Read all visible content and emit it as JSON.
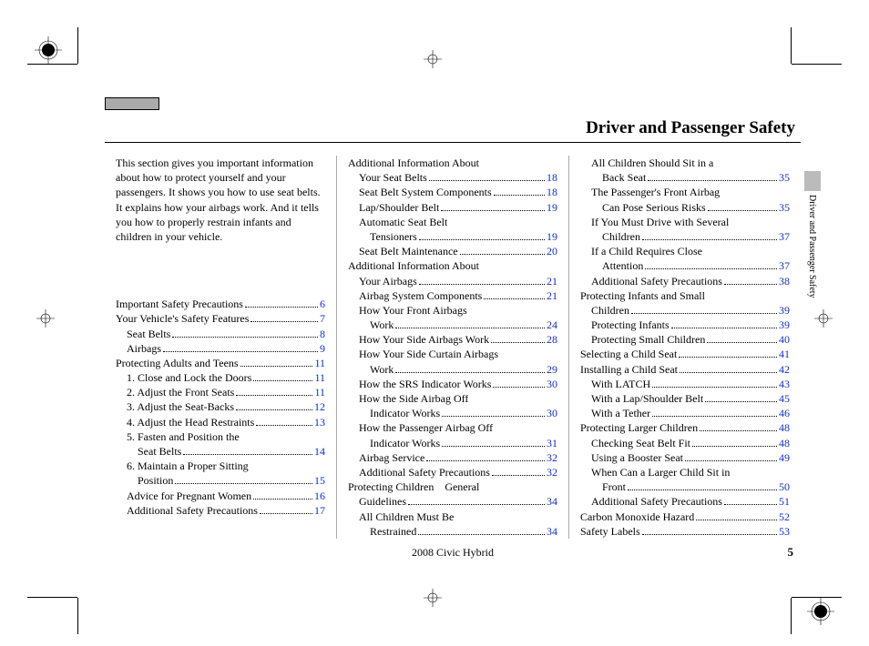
{
  "header": {
    "title": "Driver and Passenger Safety"
  },
  "intro": "This section gives you important information about how to protect yourself and your passengers. It shows you how to use seat belts. It explains how your airbags work. And it tells you how to properly restrain infants and children in your vehicle.",
  "sideLabel": "Driver and Passenger Safety",
  "footer": {
    "model": "2008  Civic  Hybrid",
    "page": "5"
  },
  "pageColor": "#1030c0",
  "col1": [
    {
      "label": "Important Safety Precautions",
      "page": "6",
      "indent": 0
    },
    {
      "label": "Your Vehicle's Safety Features",
      "page": "7",
      "indent": 0
    },
    {
      "label": "Seat Belts",
      "page": "8",
      "indent": 1
    },
    {
      "label": "Airbags",
      "page": "9",
      "indent": 1
    },
    {
      "label": "Protecting Adults and Teens",
      "page": "11",
      "indent": 0
    },
    {
      "label": "1. Close and Lock the Doors",
      "page": "11",
      "indent": 1
    },
    {
      "label": "2. Adjust the Front Seats",
      "page": "11",
      "indent": 1
    },
    {
      "label": "3. Adjust the Seat-Backs",
      "page": "12",
      "indent": 1
    },
    {
      "label": "4. Adjust the Head Restraints",
      "page": "13",
      "indent": 1
    },
    {
      "label": "5. Fasten and Position the",
      "cont": "Seat Belts",
      "page": "14",
      "indent": 1
    },
    {
      "label": "6. Maintain a Proper Sitting",
      "cont": "Position",
      "page": "15",
      "indent": 1
    },
    {
      "label": "Advice for Pregnant Women",
      "page": "16",
      "indent": 1
    },
    {
      "label": "Additional Safety Precautions",
      "page": "17",
      "indent": 1
    }
  ],
  "col2": [
    {
      "label": "Additional Information About",
      "cont": "Your Seat Belts",
      "page": "18",
      "indent": 0
    },
    {
      "label": "Seat Belt System Components",
      "page": "18",
      "indent": 1
    },
    {
      "label": "Lap/Shoulder Belt",
      "page": "19",
      "indent": 1
    },
    {
      "label": "Automatic Seat Belt",
      "cont": "Tensioners",
      "page": "19",
      "indent": 1
    },
    {
      "label": "Seat Belt Maintenance",
      "page": "20",
      "indent": 1
    },
    {
      "label": "Additional Information About",
      "cont": "Your Airbags",
      "page": "21",
      "indent": 0
    },
    {
      "label": "Airbag System Components",
      "page": "21",
      "indent": 1
    },
    {
      "label": "How Your Front Airbags",
      "cont": "Work",
      "page": "24",
      "indent": 1
    },
    {
      "label": "How Your Side Airbags Work",
      "page": "28",
      "indent": 1
    },
    {
      "label": "How Your Side Curtain Airbags",
      "cont": "Work",
      "page": "29",
      "indent": 1
    },
    {
      "label": "How the SRS Indicator Works",
      "page": "30",
      "indent": 1
    },
    {
      "label": "How the Side Airbag Off",
      "cont": "Indicator Works",
      "page": "30",
      "indent": 1
    },
    {
      "label": "How the Passenger Airbag Off",
      "cont": "Indicator Works",
      "page": "31",
      "indent": 1
    },
    {
      "label": "Airbag Service",
      "page": "32",
      "indent": 1
    },
    {
      "label": "Additional Safety Precautions",
      "page": "32",
      "indent": 1
    },
    {
      "label": "Protecting Children   General",
      "cont": "Guidelines",
      "page": "34",
      "indent": 0
    },
    {
      "label": "All Children Must Be",
      "cont": "Restrained",
      "page": "34",
      "indent": 1
    }
  ],
  "col3": [
    {
      "label": "All Children Should Sit in a",
      "cont": "Back Seat",
      "page": "35",
      "indent": 1
    },
    {
      "label": "The Passenger's Front Airbag",
      "cont": "Can Pose Serious Risks",
      "page": "35",
      "indent": 1
    },
    {
      "label": "If You Must Drive with Several",
      "cont": "Children",
      "page": "37",
      "indent": 1
    },
    {
      "label": "If a Child Requires Close",
      "cont": "Attention",
      "page": "37",
      "indent": 1
    },
    {
      "label": "Additional Safety Precautions",
      "page": "38",
      "indent": 1
    },
    {
      "label": "Protecting Infants and Small",
      "cont": "Children",
      "page": "39",
      "indent": 0
    },
    {
      "label": "Protecting Infants",
      "page": "39",
      "indent": 1
    },
    {
      "label": "Protecting Small Children",
      "page": "40",
      "indent": 1
    },
    {
      "label": "Selecting a Child Seat",
      "page": "41",
      "indent": 0
    },
    {
      "label": "Installing a Child Seat",
      "page": "42",
      "indent": 0
    },
    {
      "label": "With LATCH",
      "page": "43",
      "indent": 1
    },
    {
      "label": "With a Lap/Shoulder Belt",
      "page": "45",
      "indent": 1
    },
    {
      "label": "With a Tether",
      "page": "46",
      "indent": 1
    },
    {
      "label": "Protecting Larger Children",
      "page": "48",
      "indent": 0
    },
    {
      "label": "Checking Seat Belt Fit",
      "page": "48",
      "indent": 1
    },
    {
      "label": "Using a Booster Seat",
      "page": "49",
      "indent": 1
    },
    {
      "label": "When Can a Larger Child Sit in",
      "cont": "Front",
      "page": "50",
      "indent": 1
    },
    {
      "label": "Additional Safety Precautions",
      "page": "51",
      "indent": 1
    },
    {
      "label": "Carbon Monoxide Hazard",
      "page": "52",
      "indent": 0
    },
    {
      "label": "Safety Labels",
      "page": "53",
      "indent": 0
    }
  ]
}
